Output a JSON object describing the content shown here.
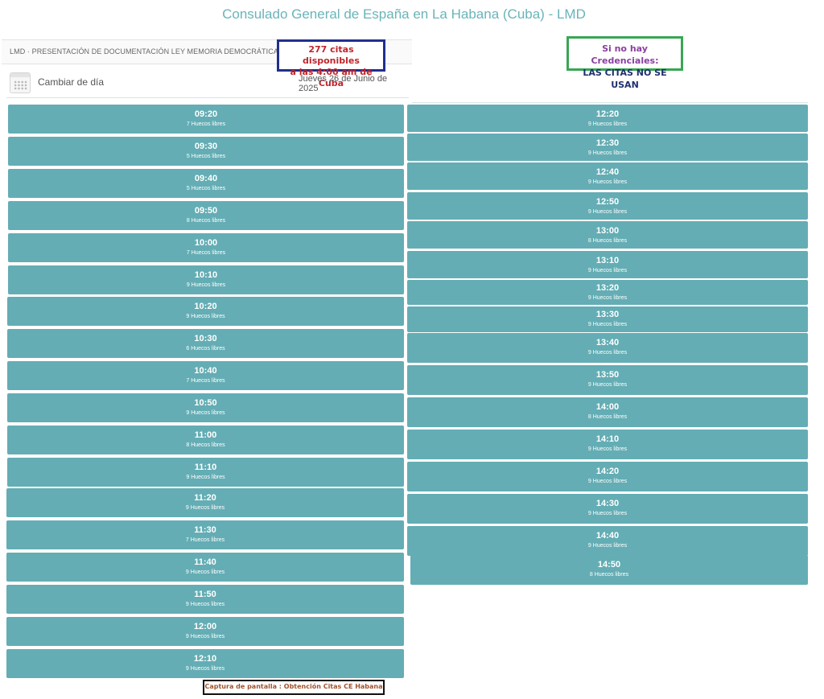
{
  "title": "Consulado General de España en La Habana (Cuba) - LMD",
  "service_label": "LMD · PRESENTACIÓN DE DOCUMENTACIÓN LEY MEMORIA DEMOCRÁTICA",
  "callout_availability": {
    "line1": "277 citas disponibles",
    "line2": "a las 4:00 am de Cuba"
  },
  "callout_credentials": {
    "line1": "Si no hay Credenciales:",
    "line2": "LAS CITAS NO SE USAN"
  },
  "day_selector": {
    "icon": "calendar-icon",
    "label": "Cambiar de día",
    "date": "Jueves 26 de Junio de 2025"
  },
  "slots_left": [
    {
      "time": "09:20",
      "free": "7 Huecos libres"
    },
    {
      "time": "09:30",
      "free": "5 Huecos libres"
    },
    {
      "time": "09:40",
      "free": "5 Huecos libres"
    },
    {
      "time": "09:50",
      "free": "8 Huecos libres"
    },
    {
      "time": "10:00",
      "free": "7 Huecos libres"
    },
    {
      "time": "10:10",
      "free": "9 Huecos libres"
    },
    {
      "time": "10:20",
      "free": "9 Huecos libres"
    },
    {
      "time": "10:30",
      "free": "6 Huecos libres"
    },
    {
      "time": "10:40",
      "free": "7 Huecos libres"
    },
    {
      "time": "10:50",
      "free": "9 Huecos libres"
    },
    {
      "time": "11:00",
      "free": "8 Huecos libres"
    },
    {
      "time": "11:10",
      "free": "9 Huecos libres"
    },
    {
      "time": "11:20",
      "free": "9 Huecos libres"
    },
    {
      "time": "11:30",
      "free": "7 Huecos libres"
    },
    {
      "time": "11:40",
      "free": "9 Huecos libres"
    },
    {
      "time": "11:50",
      "free": "9 Huecos libres"
    },
    {
      "time": "12:00",
      "free": "9 Huecos libres"
    },
    {
      "time": "12:10",
      "free": "9 Huecos libres"
    }
  ],
  "slots_right": [
    {
      "time": "12:20",
      "free": "9 Huecos libres"
    },
    {
      "time": "12:30",
      "free": "9 Huecos libres"
    },
    {
      "time": "12:40",
      "free": "9 Huecos libres"
    },
    {
      "time": "12:50",
      "free": "9 Huecos libres"
    },
    {
      "time": "13:00",
      "free": "8 Huecos libres"
    },
    {
      "time": "13:10",
      "free": "9 Huecos libres"
    },
    {
      "time": "13:20",
      "free": "9 Huecos libres"
    },
    {
      "time": "13:30",
      "free": "9 Huecos libres"
    },
    {
      "time": "13:40",
      "free": "9 Huecos libres"
    },
    {
      "time": "13:50",
      "free": "9 Huecos libres"
    },
    {
      "time": "14:00",
      "free": "8 Huecos libres"
    },
    {
      "time": "14:10",
      "free": "9 Huecos libres"
    },
    {
      "time": "14:20",
      "free": "9 Huecos libres"
    },
    {
      "time": "14:30",
      "free": "9 Huecos libres"
    },
    {
      "time": "14:40",
      "free": "9 Huecos libres"
    },
    {
      "time": "14:50",
      "free": "8 Huecos libres"
    }
  ],
  "footer_caption": "Captura de pantalla : Obtención Citas CE Habana",
  "colors": {
    "slot_bg": "#64adb4",
    "title": "#6ab4b9",
    "callout_blue_border": "#1f2f8f",
    "callout_blue_text": "#c0262d",
    "callout_green_border": "#3aa655"
  }
}
